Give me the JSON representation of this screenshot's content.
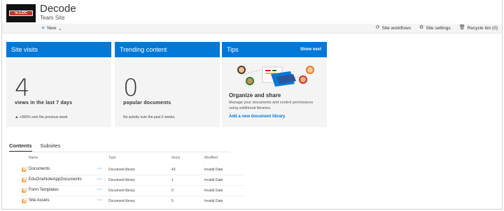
{
  "header": {
    "logo_text": "in.LOC",
    "title": "Decode",
    "subtitle": "Team Site"
  },
  "commandbar": {
    "new_label": "New",
    "site_workflows": "Site workflows",
    "site_settings": "Site settings",
    "recycle_bin": "Recycle bin (0)"
  },
  "tiles": {
    "visits": {
      "title": "Site visits",
      "number": "4",
      "label": "views in the last 7 days",
      "foot": "+300% over the previous week"
    },
    "trending": {
      "title": "Trending content",
      "number": "0",
      "label": "popular documents",
      "foot": "No activity over the past 2 weeks."
    },
    "tips": {
      "title": "Tips",
      "action": "Show next",
      "heading": "Organize and share",
      "description": "Manage your documents and control permissions using additional libraries.",
      "link": "Add a new document library"
    }
  },
  "tabs": [
    "Contents",
    "Subsites"
  ],
  "table": {
    "headers": {
      "name": "Name",
      "type": "Type",
      "items": "Items",
      "modified": "Modified"
    },
    "rows": [
      {
        "name": "Documents",
        "more": "···",
        "type": "Document library",
        "items": "43",
        "modified": "Invalid Date"
      },
      {
        "name": "EduOneNoteAppDocuments",
        "more": "···",
        "type": "Document library",
        "items": "1",
        "modified": "Invalid Date"
      },
      {
        "name": "Form Templates",
        "more": "···",
        "type": "Document library",
        "items": "0",
        "modified": "Invalid Date"
      },
      {
        "name": "Site Assets",
        "more": "···",
        "type": "Document library",
        "items": "5",
        "modified": "Invalid Date"
      }
    ]
  },
  "colors": {
    "accent": "#0078d7",
    "tile_bg": "#f4f4f4",
    "trend_up": "#107c10"
  }
}
